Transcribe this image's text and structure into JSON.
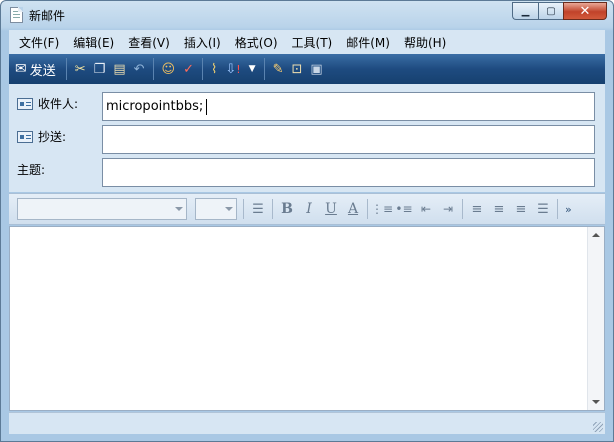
{
  "window": {
    "title": "新邮件"
  },
  "menu": [
    "文件(F)",
    "编辑(E)",
    "查看(V)",
    "插入(I)",
    "格式(O)",
    "工具(T)",
    "邮件(M)",
    "帮助(H)"
  ],
  "toolbar": {
    "send_label": "发送"
  },
  "fields": {
    "to_label": "收件人:",
    "to_value": "micropointbbs;",
    "cc_label": "抄送:",
    "cc_value": "",
    "subject_label": "主题:",
    "subject_value": ""
  },
  "format": {
    "font_name": "",
    "font_size": "",
    "bold": "B",
    "italic": "I",
    "underline": "U",
    "color": "A",
    "more": "»"
  },
  "colors": {
    "toolbar": "#1e4b80",
    "chrome": "#d7e6f3",
    "close": "#c1432a"
  }
}
